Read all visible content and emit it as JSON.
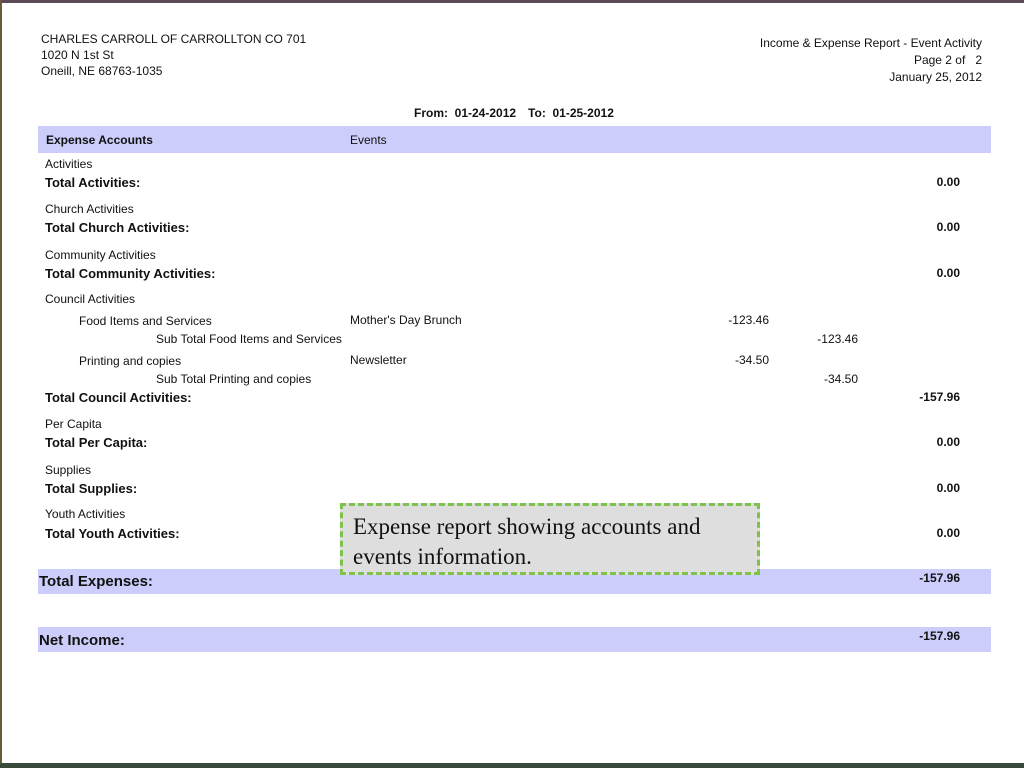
{
  "org": {
    "name": "CHARLES CARROLL OF CARROLLTON CO 701",
    "address1": "1020 N 1st St",
    "address2": "Oneill, NE 68763-1035"
  },
  "report": {
    "title": "Income & Expense Report - Event Activity",
    "page": "Page 2 of   2",
    "date": "January 25, 2012"
  },
  "range": {
    "from": "From:  01-24-2012",
    "to": "To:  01-25-2012"
  },
  "columns": {
    "accounts": "Expense Accounts",
    "events": "Events"
  },
  "sections": [
    {
      "name": "Activities",
      "total_label": "Total Activities:",
      "total": "0.00"
    },
    {
      "name": "Church Activities",
      "total_label": "Total Church Activities:",
      "total": "0.00"
    },
    {
      "name": "Community Activities",
      "total_label": "Total Community Activities:",
      "total": "0.00"
    },
    {
      "name": "Council Activities",
      "total_label": "Total Council Activities:",
      "total": "-157.96",
      "items": [
        {
          "account": "Food Items and Services",
          "event": "Mother's Day Brunch",
          "amount": "-123.46",
          "subtotal_label": "Sub Total Food Items and Services",
          "subtotal": "-123.46"
        },
        {
          "account": "Printing and copies",
          "event": "Newsletter",
          "amount": "-34.50",
          "subtotal_label": "Sub Total Printing and copies",
          "subtotal": "-34.50"
        }
      ]
    },
    {
      "name": "Per Capita",
      "total_label": "Total Per Capita:",
      "total": "0.00"
    },
    {
      "name": "Supplies",
      "total_label": "Total Supplies:",
      "total": "0.00"
    },
    {
      "name": "Youth Activities",
      "total_label": "Total Youth Activities:",
      "total": "0.00"
    }
  ],
  "totals": {
    "expenses_label": "Total Expenses:",
    "expenses": "-157.96",
    "net_label": "Net Income:",
    "net": "-157.96"
  },
  "callout": {
    "text": "Expense report showing accounts and events information."
  }
}
